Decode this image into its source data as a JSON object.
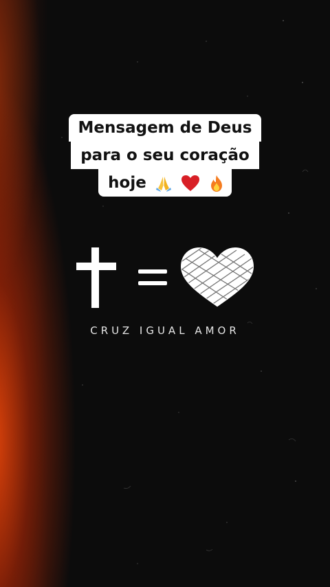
{
  "caption": {
    "line1": "Mensagem de Deus",
    "line2": "para o seu coração",
    "line3": "hoje",
    "emojis": [
      "praying-hands-icon",
      "red-heart-icon",
      "fire-icon"
    ]
  },
  "equation": {
    "left": "cross-icon",
    "operator": "equals-sign",
    "right": "scribbled-heart-icon"
  },
  "motto": "CRUZ IGUAL AMOR",
  "colors": {
    "background": "#0c0c0c",
    "flare": "#e6460a",
    "caption_bg": "#ffffff",
    "caption_text": "#111111",
    "symbol": "#ffffff"
  }
}
